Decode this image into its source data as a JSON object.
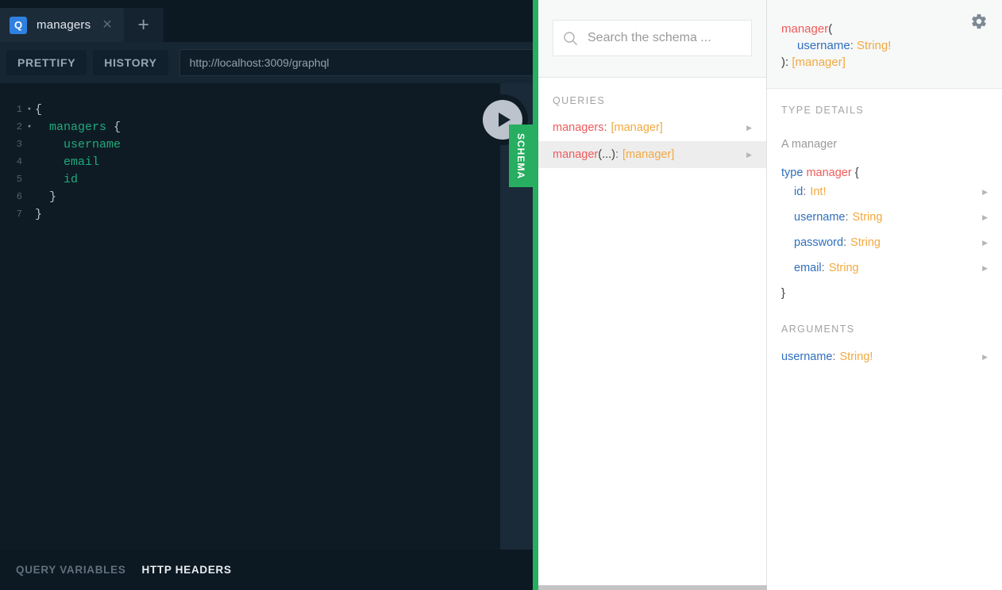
{
  "tab": {
    "badge": "Q",
    "title": "managers",
    "close_icon": "close-icon",
    "new_tab_icon": "plus-icon"
  },
  "toolbar": {
    "prettify_label": "PRETTIFY",
    "history_label": "HISTORY",
    "url_value": "http://localhost:3009/graphql"
  },
  "editor": {
    "lines": [
      {
        "number": "1",
        "fold": "▾",
        "text": "{"
      },
      {
        "number": "2",
        "fold": "▾",
        "text": "  managers {"
      },
      {
        "number": "3",
        "fold": "",
        "text": "    username"
      },
      {
        "number": "4",
        "fold": "",
        "text": "    email"
      },
      {
        "number": "5",
        "fold": "",
        "text": "    id"
      },
      {
        "number": "6",
        "fold": "",
        "text": "  }"
      },
      {
        "number": "7",
        "fold": "",
        "text": "}"
      }
    ]
  },
  "run_button": {
    "icon": "play-icon"
  },
  "schema_tab": {
    "label": "SCHEMA",
    "color": "#27ae60"
  },
  "bottom_bar": {
    "query_variables_label": "QUERY VARIABLES",
    "http_headers_label": "HTTP HEADERS"
  },
  "settings": {
    "icon": "gear-icon"
  },
  "docs": {
    "search": {
      "icon": "search-icon",
      "placeholder": "Search the schema ...",
      "value": ""
    },
    "queries_section_title": "QUERIES",
    "queries": [
      {
        "name": "managers",
        "args": "",
        "colon": ":",
        "type": "[manager]",
        "arrow": "▶",
        "selected": false
      },
      {
        "name": "manager",
        "args": "(...)",
        "colon": ":",
        "type": "[manager]",
        "arrow": "▶",
        "selected": true
      }
    ],
    "detail": {
      "header": {
        "name": "manager",
        "open_paren": "(",
        "arg_name": "username",
        "arg_colon": ":",
        "arg_type": "String!",
        "close_paren": "):",
        "return_type": "[manager]"
      },
      "type_details_title": "TYPE DETAILS",
      "description": "A manager",
      "type_keyword": "type",
      "type_name": "manager",
      "open_brace": "{",
      "close_brace": "}",
      "fields": [
        {
          "name": "id",
          "colon": ":",
          "type": "Int!",
          "arrow": "▶"
        },
        {
          "name": "username",
          "colon": ":",
          "type": "String",
          "arrow": "▶"
        },
        {
          "name": "password",
          "colon": ":",
          "type": "String",
          "arrow": "▶"
        },
        {
          "name": "email",
          "colon": ":",
          "type": "String",
          "arrow": "▶"
        }
      ],
      "arguments_title": "ARGUMENTS",
      "arguments": [
        {
          "name": "username",
          "colon": ":",
          "type": "String!",
          "arrow": "▶"
        }
      ]
    }
  },
  "colors": {
    "accent_green": "#27ae60",
    "badge_blue": "#2f80e0",
    "field_green": "#1fa97a",
    "docs_name_red": "#ef5b5b",
    "docs_type_orange": "#f2a940",
    "docs_arg_blue": "#2f6fbd"
  }
}
